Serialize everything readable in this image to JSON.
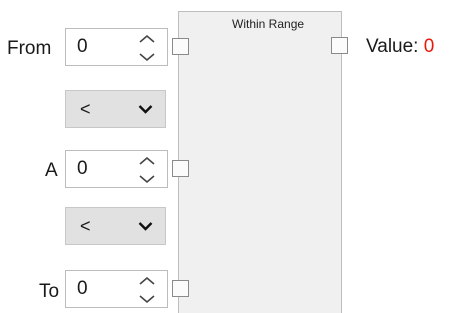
{
  "node": {
    "title": "Within Range"
  },
  "inputs": {
    "from": {
      "label": "From",
      "value": "0"
    },
    "a": {
      "label": "A",
      "value": "0"
    },
    "to": {
      "label": "To",
      "value": "0"
    }
  },
  "comparators": {
    "first": {
      "selected": "<"
    },
    "second": {
      "selected": "<"
    }
  },
  "output": {
    "label": "Value:",
    "value": "0",
    "value_color": "#e8190c"
  }
}
